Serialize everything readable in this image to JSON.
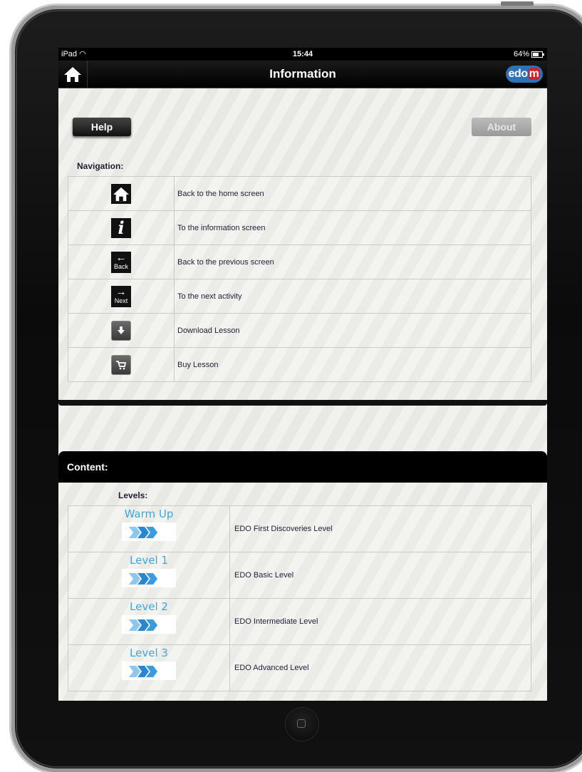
{
  "status_bar": {
    "device": "iPad",
    "time": "15:44",
    "battery": "64%"
  },
  "nav_bar": {
    "title": "Information",
    "logo_text": "edo",
    "logo_m": "m"
  },
  "tabs": {
    "help": "Help",
    "about": "About"
  },
  "navigation": {
    "label": "Navigation:",
    "rows": [
      {
        "icon": "home-icon",
        "text": "Back to the home screen"
      },
      {
        "icon": "info-icon",
        "text": "To the information screen"
      },
      {
        "icon": "back-icon",
        "icon_caption": "Back",
        "text": "Back to the previous screen"
      },
      {
        "icon": "next-icon",
        "icon_caption": "Next",
        "text": "To the next activity"
      },
      {
        "icon": "download-icon",
        "text": "Download Lesson"
      },
      {
        "icon": "cart-icon",
        "text": "Buy Lesson"
      }
    ]
  },
  "content": {
    "title": "Content:",
    "levels_label": "Levels:",
    "levels": [
      {
        "name": "Warm Up",
        "text": "EDO First Discoveries Level"
      },
      {
        "name": "Level 1",
        "text": "EDO Basic Level"
      },
      {
        "name": "Level 2",
        "text": "EDO Intermediate Level"
      },
      {
        "name": "Level 3",
        "text": "EDO Advanced Level"
      }
    ]
  },
  "colors": {
    "level_text": "#3aa7e4",
    "logo_blue": "#2f72b8",
    "logo_red": "#d21f2a"
  }
}
